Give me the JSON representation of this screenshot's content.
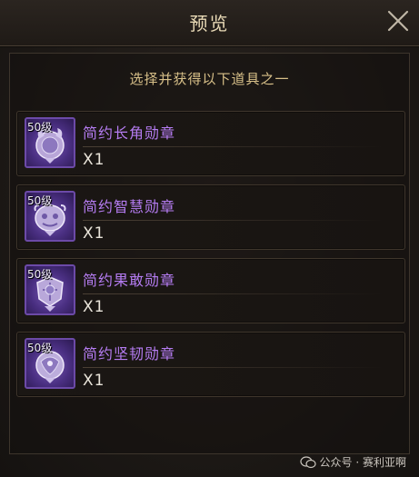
{
  "dialog": {
    "title": "预览",
    "subtitle": "选择并获得以下道具之一"
  },
  "items": [
    {
      "level": "50级",
      "name": "简约长角勋章",
      "quantity": "X1",
      "icon": "horn-medal-icon"
    },
    {
      "level": "50级",
      "name": "简约智慧勋章",
      "quantity": "X1",
      "icon": "wisdom-medal-icon"
    },
    {
      "level": "50级",
      "name": "简约果敢勋章",
      "quantity": "X1",
      "icon": "courage-medal-icon"
    },
    {
      "level": "50级",
      "name": "简约坚韧勋章",
      "quantity": "X1",
      "icon": "tenacity-medal-icon"
    }
  ],
  "watermark": {
    "text": "公众号 · 赛利亚啊",
    "icon": "wechat-icon"
  },
  "colors": {
    "title": "#e8d9b5",
    "subtitle": "#d8c089",
    "item_name": "#b57cf2",
    "quantity": "#e9e4da",
    "icon_border": "#6c4aa8"
  }
}
